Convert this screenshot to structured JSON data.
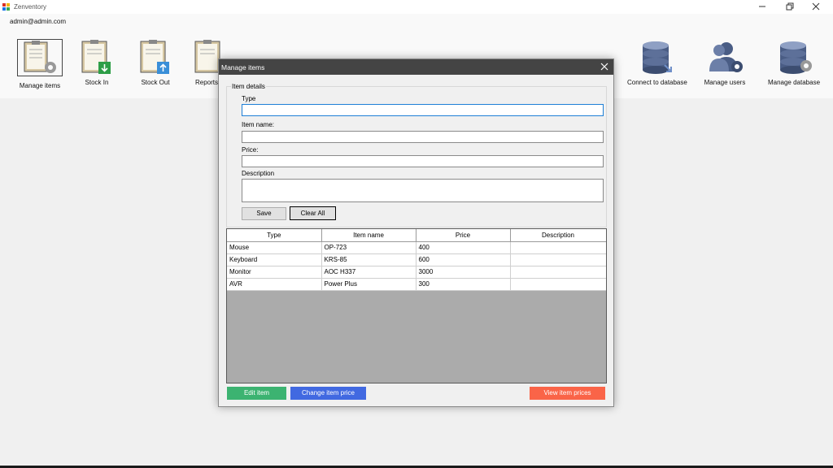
{
  "window": {
    "title": "Zenventory",
    "user": "admin@admin.com"
  },
  "toolbar": {
    "left": [
      {
        "label": "Manage items",
        "icon": "clipboard-gear-icon"
      },
      {
        "label": "Stock In",
        "icon": "clipboard-arrow-down-icon"
      },
      {
        "label": "Stock Out",
        "icon": "clipboard-arrow-up-icon"
      },
      {
        "label": "Reports",
        "icon": "clipboard-report-icon"
      }
    ],
    "right": [
      {
        "label": "Connect to database",
        "icon": "database-connect-icon"
      },
      {
        "label": "Manage users",
        "icon": "users-gear-icon"
      },
      {
        "label": "Manage database",
        "icon": "database-gear-icon"
      }
    ]
  },
  "dialog": {
    "title": "Manage items",
    "group_title": "Item details",
    "fields": {
      "type_label": "Type",
      "type_value": "",
      "name_label": "Item name:",
      "name_value": "",
      "price_label": "Price:",
      "price_value": "",
      "desc_label": "Description",
      "desc_value": ""
    },
    "save_label": "Save",
    "clear_label": "Clear All",
    "table": {
      "columns": [
        "Type",
        "Item name",
        "Price",
        "Description"
      ],
      "rows": [
        [
          "Mouse",
          "OP-723",
          "400",
          ""
        ],
        [
          "Keyboard",
          "KRS-85",
          "600",
          ""
        ],
        [
          "Monitor",
          "AOC H337",
          "3000",
          ""
        ],
        [
          "AVR",
          "Power Plus",
          "300",
          ""
        ]
      ]
    },
    "edit_label": "Edit item",
    "change_label": "Change item price",
    "view_label": "View item prices"
  },
  "colors": {
    "edit": "#3cb371",
    "change": "#4169e1",
    "view": "#fa6448",
    "dialog_title": "#444444"
  }
}
